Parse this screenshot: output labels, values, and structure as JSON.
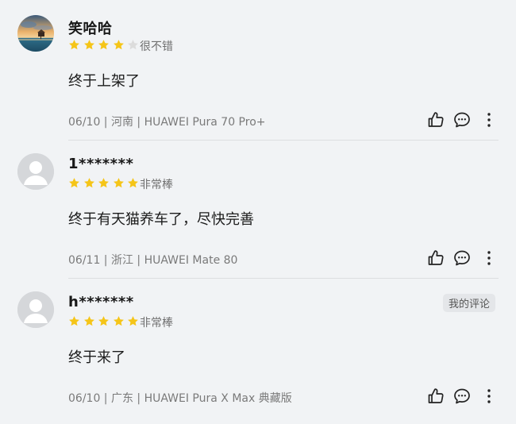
{
  "reviews": [
    {
      "username": "笑哈哈",
      "rating": 4,
      "rating_text": "很不错",
      "content": "终于上架了",
      "meta": "06/10 | 河南 | HUAWEI Pura 70 Pro+",
      "avatar": "landscape-photo-avatar",
      "is_mine": false
    },
    {
      "username": "1*******",
      "rating": 5,
      "rating_text": "非常棒",
      "content": "终于有天猫养车了，尽快完善",
      "meta": "06/11 | 浙江 | HUAWEI Mate 80",
      "avatar": "default-user-avatar",
      "is_mine": false
    },
    {
      "username": "h*******",
      "rating": 5,
      "rating_text": "非常棒",
      "content": "终于来了",
      "meta": "06/10 | 广东 | HUAWEI Pura X Max 典藏版",
      "avatar": "default-user-avatar",
      "is_mine": true,
      "badge": "我的评论"
    }
  ],
  "icons": {
    "like": "thumbs-up-icon",
    "comment": "comment-bubble-icon",
    "more": "more-vertical-icon"
  },
  "colors": {
    "star_filled": "#f5c518",
    "star_empty": "#dcdcdc",
    "background": "#f1f3f5"
  }
}
